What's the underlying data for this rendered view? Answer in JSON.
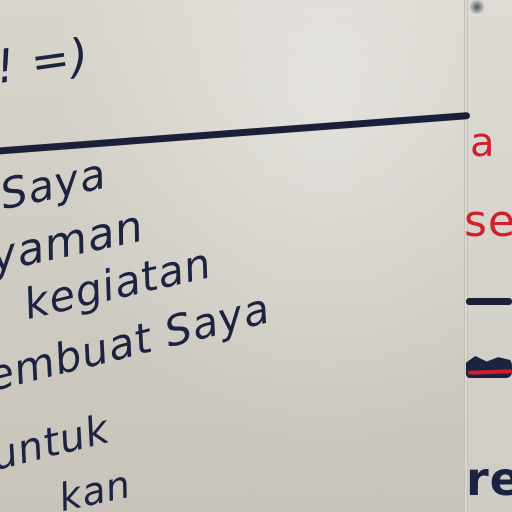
{
  "board_left": {
    "lines": [
      "! =)",
      "Saya",
      "yaman",
      "kegiatan",
      "embuat Saya",
      "untuk",
      "kan"
    ]
  },
  "board_right": {
    "fragments": [
      "a",
      "se",
      "re"
    ]
  },
  "colors": {
    "marker_blue": "#1c2340",
    "marker_red": "#d0202c",
    "board": "#d0ccc4"
  }
}
